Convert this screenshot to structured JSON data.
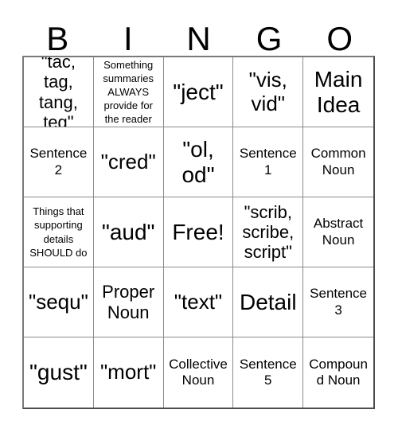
{
  "card": {
    "type": "bingo-card",
    "columns": 5,
    "rows": 5,
    "header": {
      "letters": [
        "B",
        "I",
        "N",
        "G",
        "O"
      ]
    },
    "cells": [
      {
        "text": "\"tac, tag, tang, teg\"",
        "size": "md",
        "free": false
      },
      {
        "text": "Something summaries ALWAYS provide for the reader",
        "size": "xs",
        "free": false
      },
      {
        "text": "\"ject\"",
        "size": "xl",
        "free": false
      },
      {
        "text": "\"vis, vid\"",
        "size": "lg",
        "free": false
      },
      {
        "text": "Main Idea",
        "size": "xl",
        "free": false
      },
      {
        "text": "Sentence 2",
        "size": "sm",
        "free": false
      },
      {
        "text": "\"cred\"",
        "size": "lg",
        "free": false
      },
      {
        "text": "\"ol, od\"",
        "size": "xl",
        "free": false
      },
      {
        "text": "Sentence 1",
        "size": "sm",
        "free": false
      },
      {
        "text": "Common Noun",
        "size": "sm",
        "free": false
      },
      {
        "text": "Things that supporting details SHOULD do",
        "size": "xs",
        "free": false
      },
      {
        "text": "\"aud\"",
        "size": "xl",
        "free": false
      },
      {
        "text": "Free!",
        "size": "xl",
        "free": true
      },
      {
        "text": "\"scrib, scribe, script\"",
        "size": "md",
        "free": false
      },
      {
        "text": "Abstract Noun",
        "size": "sm",
        "free": false
      },
      {
        "text": "\"sequ\"",
        "size": "lg",
        "free": false
      },
      {
        "text": "Proper Noun",
        "size": "md",
        "free": false
      },
      {
        "text": "\"text\"",
        "size": "lg",
        "free": false
      },
      {
        "text": "Detail",
        "size": "xl",
        "free": false
      },
      {
        "text": "Sentence 3",
        "size": "sm",
        "free": false
      },
      {
        "text": "\"gust\"",
        "size": "xl",
        "free": false
      },
      {
        "text": "\"mort\"",
        "size": "lg",
        "free": false
      },
      {
        "text": "Collective Noun",
        "size": "sm",
        "free": false
      },
      {
        "text": "Sentence 5",
        "size": "sm",
        "free": false
      },
      {
        "text": "Compound Noun",
        "size": "sm",
        "free": false
      }
    ]
  }
}
